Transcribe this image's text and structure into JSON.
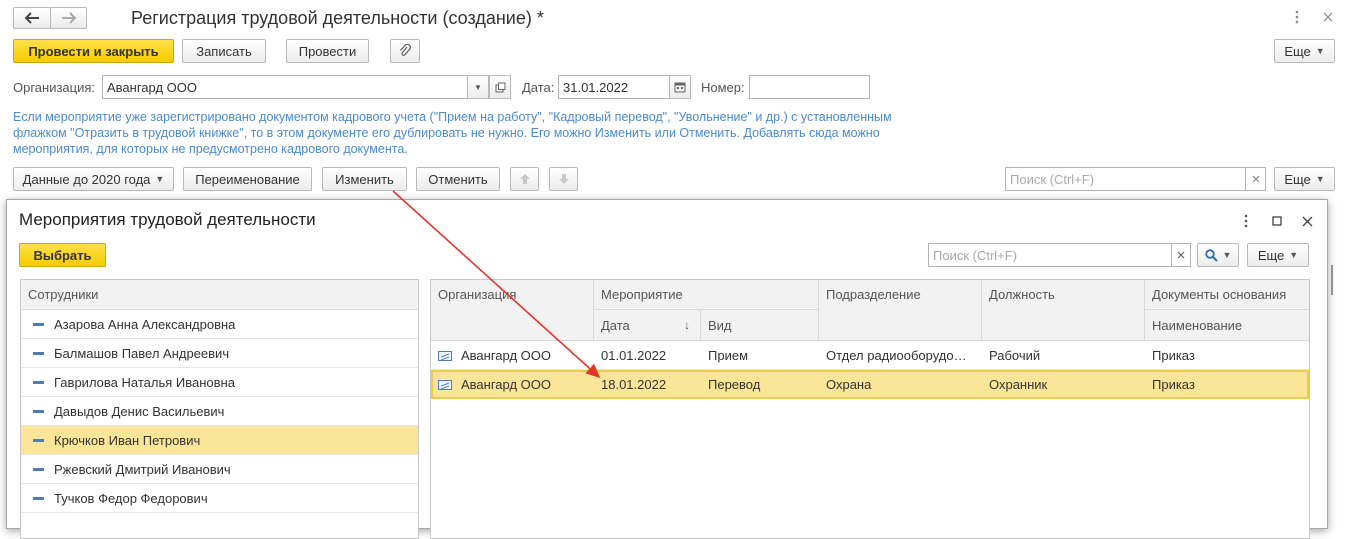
{
  "window": {
    "title": "Регистрация трудовой деятельности (создание) *"
  },
  "toolbar": {
    "post_close": "Провести и закрыть",
    "save": "Записать",
    "post": "Провести",
    "more": "Еще"
  },
  "form": {
    "org_label": "Организация:",
    "org_value": "Авангард ООО",
    "date_label": "Дата:",
    "date_value": "31.01.2022",
    "number_label": "Номер:",
    "number_value": ""
  },
  "hint": {
    "line1": "Если мероприятие уже зарегистрировано документом кадрового учета (\"Прием на работу\", \"Кадровый перевод\", \"Увольнение\" и др.) с установленным",
    "line2": "флажком \"Отразить в трудовой книжке\", то в этом документе его дублировать не нужно. Его можно Изменить или Отменить. Добавлять сюда можно",
    "line3": "мероприятия, для которых не предусмотрено кадрового документа."
  },
  "table_toolbar": {
    "data_2020": "Данные до 2020 года",
    "rename": "Переименование",
    "change": "Изменить",
    "cancel": "Отменить",
    "search_placeholder": "Поиск (Ctrl+F)",
    "more": "Еще"
  },
  "dialog": {
    "title": "Мероприятия трудовой деятельности",
    "select": "Выбрать",
    "search_placeholder": "Поиск (Ctrl+F)",
    "more": "Еще",
    "employees_header": "Сотрудники",
    "employees": [
      "Азарова Анна Александровна",
      "Балмашов Павел Андреевич",
      "Гаврилова Наталья Ивановна",
      "Давыдов Денис Васильевич",
      "Крючков Иван Петрович",
      "Ржевский Дмитрий Иванович",
      "Тучков Федор Федорович"
    ],
    "selected_employee_index": 4,
    "columns": {
      "org": "Организация",
      "event": "Мероприятие",
      "date": "Дата",
      "kind": "Вид",
      "dept": "Подразделение",
      "position": "Должность",
      "docs": "Документы основания",
      "docname": "Наименование"
    },
    "events": [
      {
        "org": "Авангард ООО",
        "date": "01.01.2022",
        "kind": "Прием",
        "dept": "Отдел радиооборудо…",
        "position": "Рабочий",
        "doc": "Приказ"
      },
      {
        "org": "Авангард ООО",
        "date": "18.01.2022",
        "kind": "Перевод",
        "dept": "Охрана",
        "position": "Охранник",
        "doc": "Приказ"
      }
    ],
    "selected_event_index": 1
  }
}
